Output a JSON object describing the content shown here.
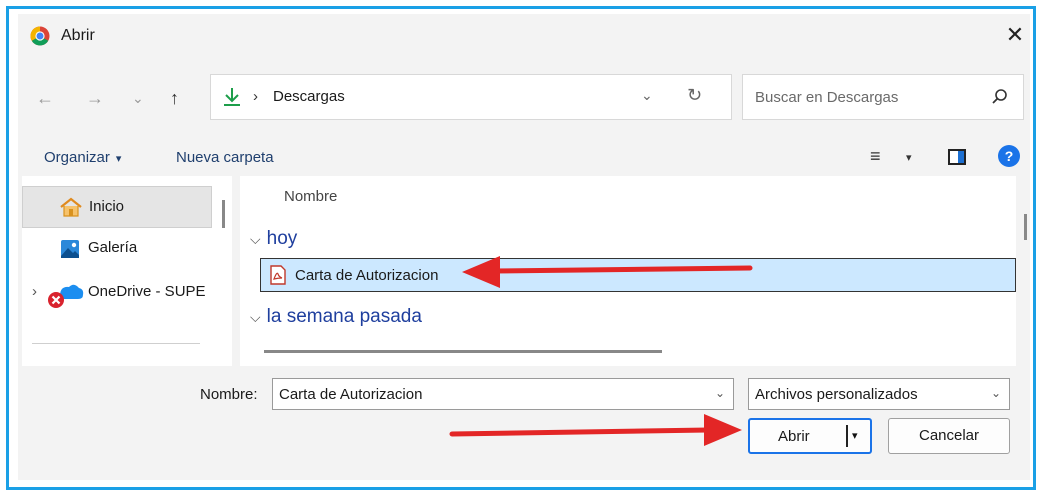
{
  "window": {
    "title": "Abrir",
    "close_glyph": "✕",
    "app_icon": "chrome-icon"
  },
  "nav": {
    "back_glyph": "←",
    "forward_glyph": "→",
    "recent_glyph": "⌄",
    "up_glyph": "↑",
    "address": {
      "folder_icon": "download-icon",
      "separator": "›",
      "location": "Descargas",
      "dropdown_glyph": "⌄",
      "refresh_glyph": "↻"
    },
    "search": {
      "placeholder": "Buscar en Descargas",
      "icon": "search-icon"
    }
  },
  "commands": {
    "organize": "Organizar",
    "caret": "▾",
    "new_folder": "Nueva carpeta",
    "view_glyph": "≡",
    "view_caret": "▾",
    "help_glyph": "?"
  },
  "sidebar": {
    "items": [
      {
        "label": "Inicio",
        "icon": "home-icon",
        "selected": true
      },
      {
        "label": "Galería",
        "icon": "gallery-icon",
        "selected": false
      },
      {
        "label": "OneDrive - SUPE",
        "icon": "onedrive-icon",
        "expand_glyph": "›",
        "selected": false
      }
    ]
  },
  "files": {
    "column_header": "Nombre",
    "groups": [
      {
        "label": "hoy",
        "chevron": "⌵"
      },
      {
        "label": "la semana pasada",
        "chevron": "⌵"
      }
    ],
    "items": [
      {
        "name": "Carta de Autorizacion",
        "icon": "pdf-icon",
        "selected": true
      }
    ]
  },
  "footer": {
    "name_label": "Nombre:",
    "name_value": "Carta de Autorizacion",
    "name_dropdown_glyph": "⌄",
    "file_type": "Archivos personalizados",
    "file_type_dropdown_glyph": "⌄",
    "open_label": "Abrir",
    "open_caret": "▾",
    "cancel_label": "Cancelar"
  },
  "annotations": {
    "arrow_color": "#e32626"
  },
  "colors": {
    "frame": "#1aa0e6",
    "selection": "#cce8ff",
    "accent": "#1a73e8",
    "link": "#1f3f6e"
  }
}
